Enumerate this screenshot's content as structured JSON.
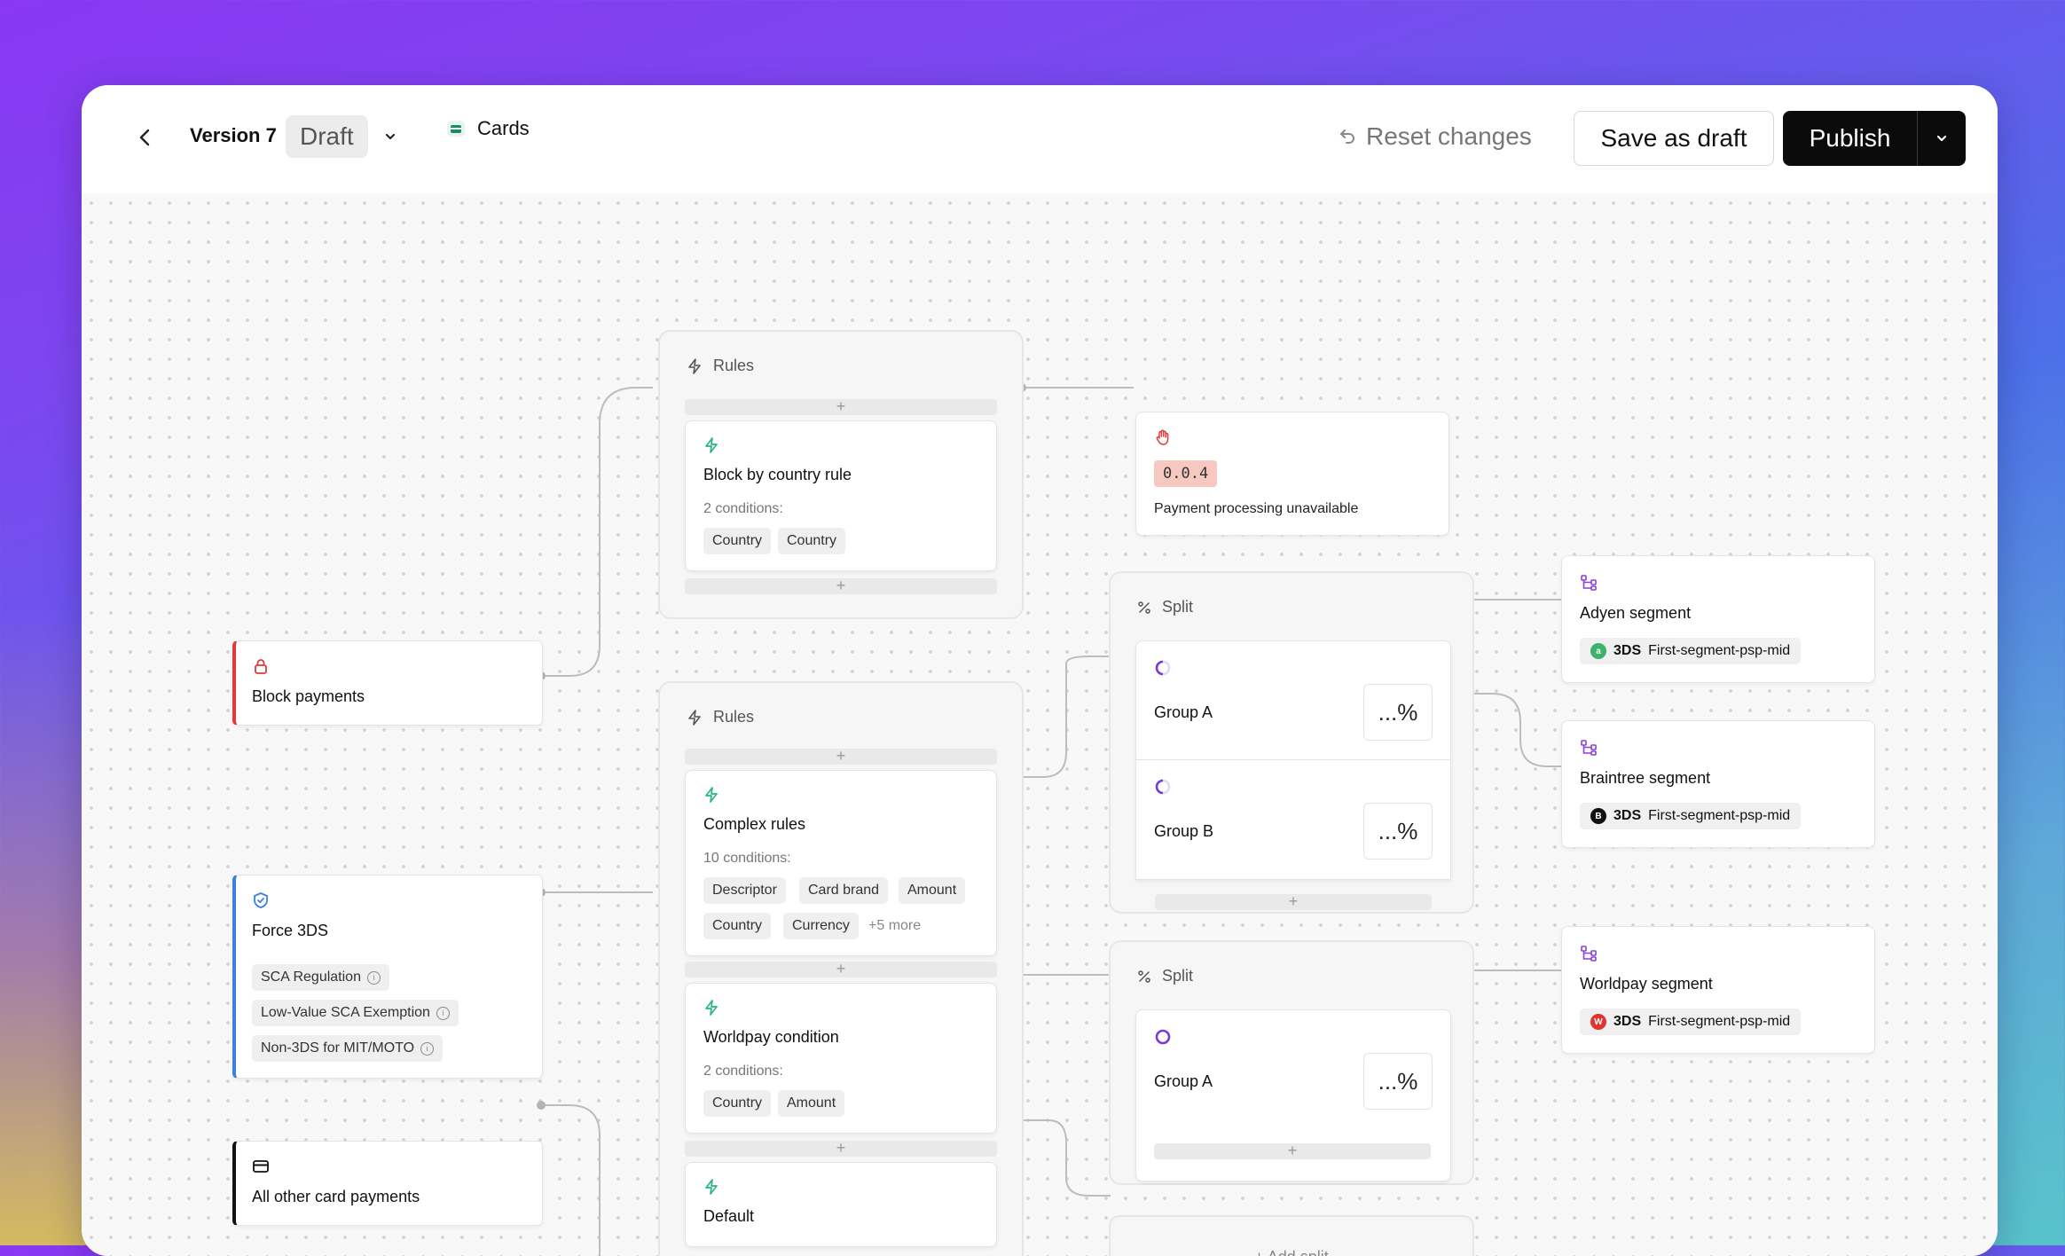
{
  "header": {
    "version_label": "Version 7",
    "status_label": "Draft",
    "channel_label": "Cards",
    "reset_label": "Reset changes",
    "save_label": "Save as draft",
    "publish_label": "Publish"
  },
  "left_nodes": [
    {
      "title": "Block payments"
    },
    {
      "title": "Force 3DS",
      "chips": [
        "SCA Regulation",
        "Low-Value SCA Exemption",
        "Non-3DS for MIT/MOTO"
      ]
    },
    {
      "title": "All other card payments"
    }
  ],
  "rules_groups": [
    {
      "title": "Rules",
      "add": "+",
      "rules": [
        {
          "title": "Block by country rule",
          "conditions_label": "2 conditions:",
          "chips": [
            "Country",
            "Country"
          ]
        }
      ]
    },
    {
      "title": "Rules",
      "add": "+",
      "rules": [
        {
          "title": "Complex rules",
          "conditions_label": "10 conditions:",
          "chips": [
            "Descriptor",
            "Card brand",
            "Amount",
            "Country",
            "Currency"
          ],
          "more": "+5 more"
        },
        {
          "title": "Worldpay condition",
          "conditions_label": "2 conditions:",
          "chips": [
            "Country",
            "Amount"
          ]
        },
        {
          "title": "Default"
        }
      ]
    }
  ],
  "error_node": {
    "code": "0.0.4",
    "message": "Payment processing unavailable"
  },
  "splits": [
    {
      "title": "Split",
      "groups": [
        {
          "name": "Group A",
          "percent": "...%"
        },
        {
          "name": "Group B",
          "percent": "...%"
        }
      ]
    },
    {
      "title": "Split",
      "groups": [
        {
          "name": "Group A",
          "percent": "...%"
        }
      ]
    }
  ],
  "add_split_label": "+ Add split",
  "segments": [
    {
      "name": "Adyen segment",
      "badge": "3DS",
      "label": "First-segment-psp-mid",
      "psp_initial": "a",
      "psp_color": "#3bb36a"
    },
    {
      "name": "Braintree segment",
      "badge": "3DS",
      "label": "First-segment-psp-mid",
      "psp_initial": "B",
      "psp_color": "#111111"
    },
    {
      "name": "Worldpay segment",
      "badge": "3DS",
      "label": "First-segment-psp-mid",
      "psp_initial": "W",
      "psp_color": "#e2332c"
    }
  ],
  "colors": {
    "block": "#e03a3a",
    "force3ds": "#3b7fe0",
    "allother": "#111111",
    "rule_icon": "#2bb38a",
    "split_icon": "#7a3ad9",
    "segment_icon": "#8a3fd9"
  }
}
